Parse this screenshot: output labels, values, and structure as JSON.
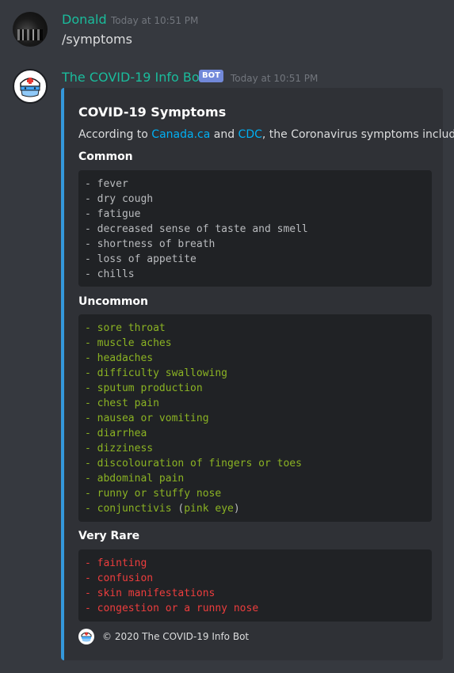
{
  "messages": {
    "user": {
      "username": "Donald",
      "timestamp": "Today at 10:51 PM",
      "text": "/symptoms"
    },
    "bot": {
      "username": "The COVID-19 Info Bot",
      "tag": "BOT",
      "timestamp": "Today at 10:51 PM"
    }
  },
  "embed": {
    "title": "COVID-19 Symptoms",
    "desc_prefix": "According to ",
    "link1": "Canada.ca",
    "desc_mid": " and ",
    "link2": "CDC",
    "desc_suffix": ", the Coronavirus symptoms include:",
    "common_title": "Common",
    "common": [
      "- fever",
      "- dry cough",
      "- fatigue",
      "- decreased sense of taste and smell",
      "- shortness of breath",
      "- loss of appetite",
      "- chills"
    ],
    "uncommon_title": "Uncommon",
    "uncommon": [
      "- sore throat",
      "- muscle aches",
      "- headaches",
      "- difficulty swallowing",
      "- sputum production",
      "- chest pain",
      "- nausea or vomiting",
      "- diarrhea",
      "- dizziness",
      "- discolouration of fingers or toes",
      "- abdominal pain",
      "- runny or stuffy nose"
    ],
    "uncommon_last_a": "- conjunctivis ",
    "uncommon_last_b": "(",
    "uncommon_last_c": "pink eye",
    "uncommon_last_d": ")",
    "rare_title": "Very Rare",
    "rare": [
      "- fainting",
      "- confusion",
      "- skin manifestations",
      "- congestion or a runny nose"
    ],
    "footer": "© 2020 The COVID-19 Info Bot",
    "colors": {
      "accent": "#3498db",
      "common": "#b9bbbe",
      "uncommon": "#8bb323",
      "rare": "#ed3d3d",
      "link": "#00b0f4"
    }
  }
}
